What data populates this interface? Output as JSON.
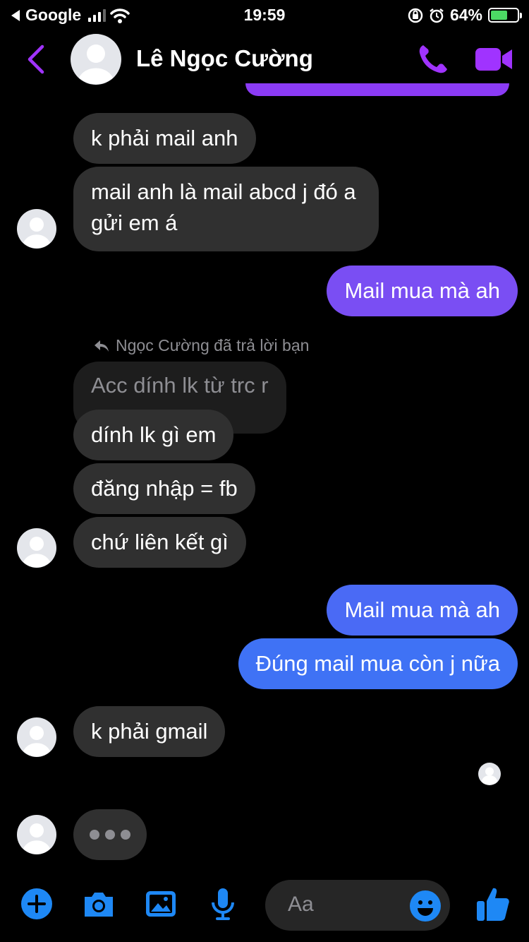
{
  "status_bar": {
    "carrier": "Google",
    "time": "19:59",
    "battery_percent": "64%"
  },
  "header": {
    "contact_name": "Lê Ngọc Cường"
  },
  "messages": [
    {
      "text": "k phải mail anh"
    },
    {
      "line1": "mail anh là mail abcd j đó a",
      "line2": "gửi em á"
    },
    {
      "text": "Mail mua mà ah"
    },
    {
      "reply_note": "Ngọc Cường đã trả lời bạn",
      "quoted": "Acc dính lk từ trc r"
    },
    {
      "text": "dính lk gì em"
    },
    {
      "text": "đăng nhập = fb"
    },
    {
      "text": "chứ liên kết gì"
    },
    {
      "text": "Mail mua mà ah"
    },
    {
      "text": "Đúng mail mua còn j nữa"
    },
    {
      "text": "k phải gmail"
    }
  ],
  "composer": {
    "placeholder": "Aa"
  },
  "colors": {
    "accent": "#a033ff",
    "outgoing_purple": "#7a4ef3",
    "outgoing_blue": "#3f72f5",
    "incoming": "#303030",
    "composer_icons": "#1e88f5"
  },
  "icons": [
    "back-icon",
    "avatar-icon",
    "phone-icon",
    "video-icon",
    "reply-icon",
    "plus-icon",
    "camera-icon",
    "image-icon",
    "microphone-icon",
    "emoji-icon",
    "thumbs-up-icon"
  ]
}
